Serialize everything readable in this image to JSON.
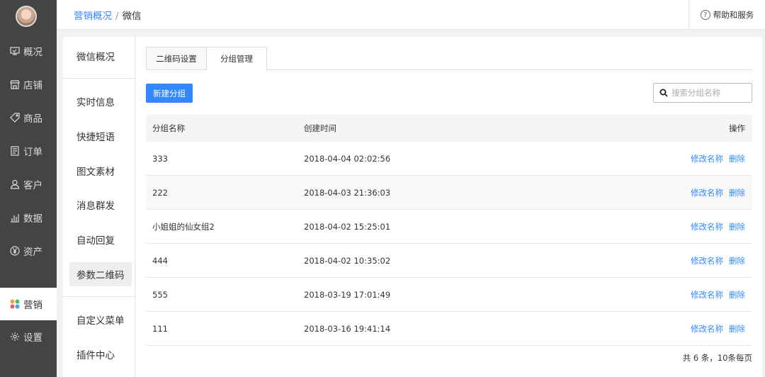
{
  "nav": {
    "items": [
      {
        "label": "概况",
        "icon": "overview-icon"
      },
      {
        "label": "店铺",
        "icon": "shop-icon"
      },
      {
        "label": "商品",
        "icon": "tag-icon"
      },
      {
        "label": "订单",
        "icon": "order-icon"
      },
      {
        "label": "客户",
        "icon": "user-icon"
      },
      {
        "label": "数据",
        "icon": "chart-icon"
      },
      {
        "label": "资产",
        "icon": "yuan-icon"
      },
      {
        "label": "营销",
        "icon": "marketing-icon",
        "active": true
      },
      {
        "label": "设置",
        "icon": "gear-icon"
      }
    ]
  },
  "header": {
    "breadcrumb": {
      "parent": "营销概况",
      "separator": "/",
      "current": "微信"
    },
    "help": {
      "icon": "question-icon",
      "label": "帮助和服务"
    }
  },
  "subnav": {
    "items": [
      {
        "label": "微信概况"
      },
      {
        "label": "实时信息"
      },
      {
        "label": "快捷短语"
      },
      {
        "label": "图文素材"
      },
      {
        "label": "消息群发"
      },
      {
        "label": "自动回复"
      },
      {
        "label": "参数二维码",
        "active": true
      },
      {
        "label": "自定义菜单"
      },
      {
        "label": "插件中心"
      }
    ]
  },
  "tabs": [
    {
      "label": "二维码设置"
    },
    {
      "label": "分组管理",
      "active": true
    }
  ],
  "toolbar": {
    "new_button": "新建分组",
    "search_placeholder": "搜索分组名称"
  },
  "table": {
    "columns": [
      "分组名称",
      "创建时间",
      "操作"
    ],
    "rows": [
      {
        "name": "333",
        "time": "2018-04-04 02:02:56"
      },
      {
        "name": "222",
        "time": "2018-04-03 21:36:03"
      },
      {
        "name": "小姐姐的仙女组2",
        "time": "2018-04-02 15:25:01"
      },
      {
        "name": "444",
        "time": "2018-04-02 10:35:02"
      },
      {
        "name": "555",
        "time": "2018-03-19 17:01:49"
      },
      {
        "name": "111",
        "time": "2018-03-16 19:41:14"
      }
    ],
    "actions": {
      "rename": "修改名称",
      "delete": "删除"
    }
  },
  "pager": {
    "summary": "共 6 条，10条每页"
  },
  "colors": {
    "accent": "#3388ff",
    "sidebar": "#444444"
  }
}
